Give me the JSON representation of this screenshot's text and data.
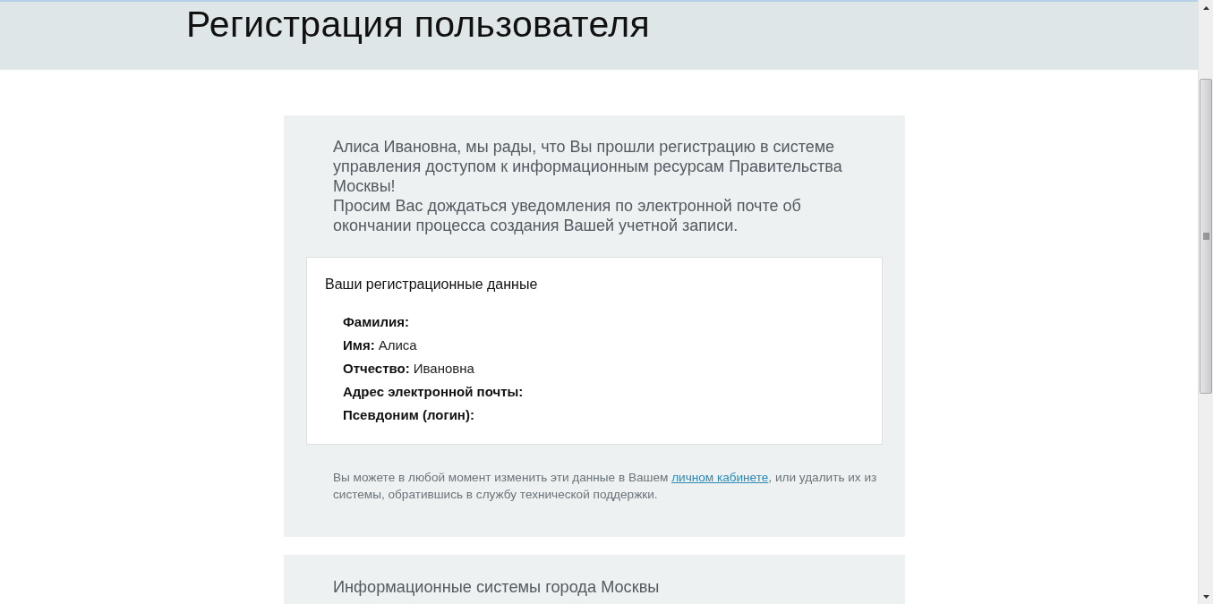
{
  "header": {
    "title": "Регистрация пользователя"
  },
  "confirmation": {
    "message": [
      "Алиса Ивановна, мы рады, что Вы прошли регистрацию в системе управления доступом к информационным ресурсам Правительства Москвы!",
      "Просим Вас дождаться уведомления по электронной почте об окончании процесса создания Вашей учетной записи."
    ],
    "details": {
      "heading": "Ваши регистрационные данные",
      "fields": [
        {
          "label": "Фамилия:"
        },
        {
          "label": "Имя:",
          "value": "Алиса"
        },
        {
          "label": "Отчество:",
          "value": "Ивановна"
        },
        {
          "label": "Адрес электронной почты:"
        },
        {
          "label": "Псевдоним (логин):"
        }
      ]
    },
    "note": {
      "before": "Вы можете в любой момент изменить эти данные в Вашем ",
      "link": "личном кабинете",
      "after": ", или удалить их из системы, обратившись в службу технической поддержки."
    }
  },
  "systems": {
    "title": "Информационные системы города Москвы"
  }
}
